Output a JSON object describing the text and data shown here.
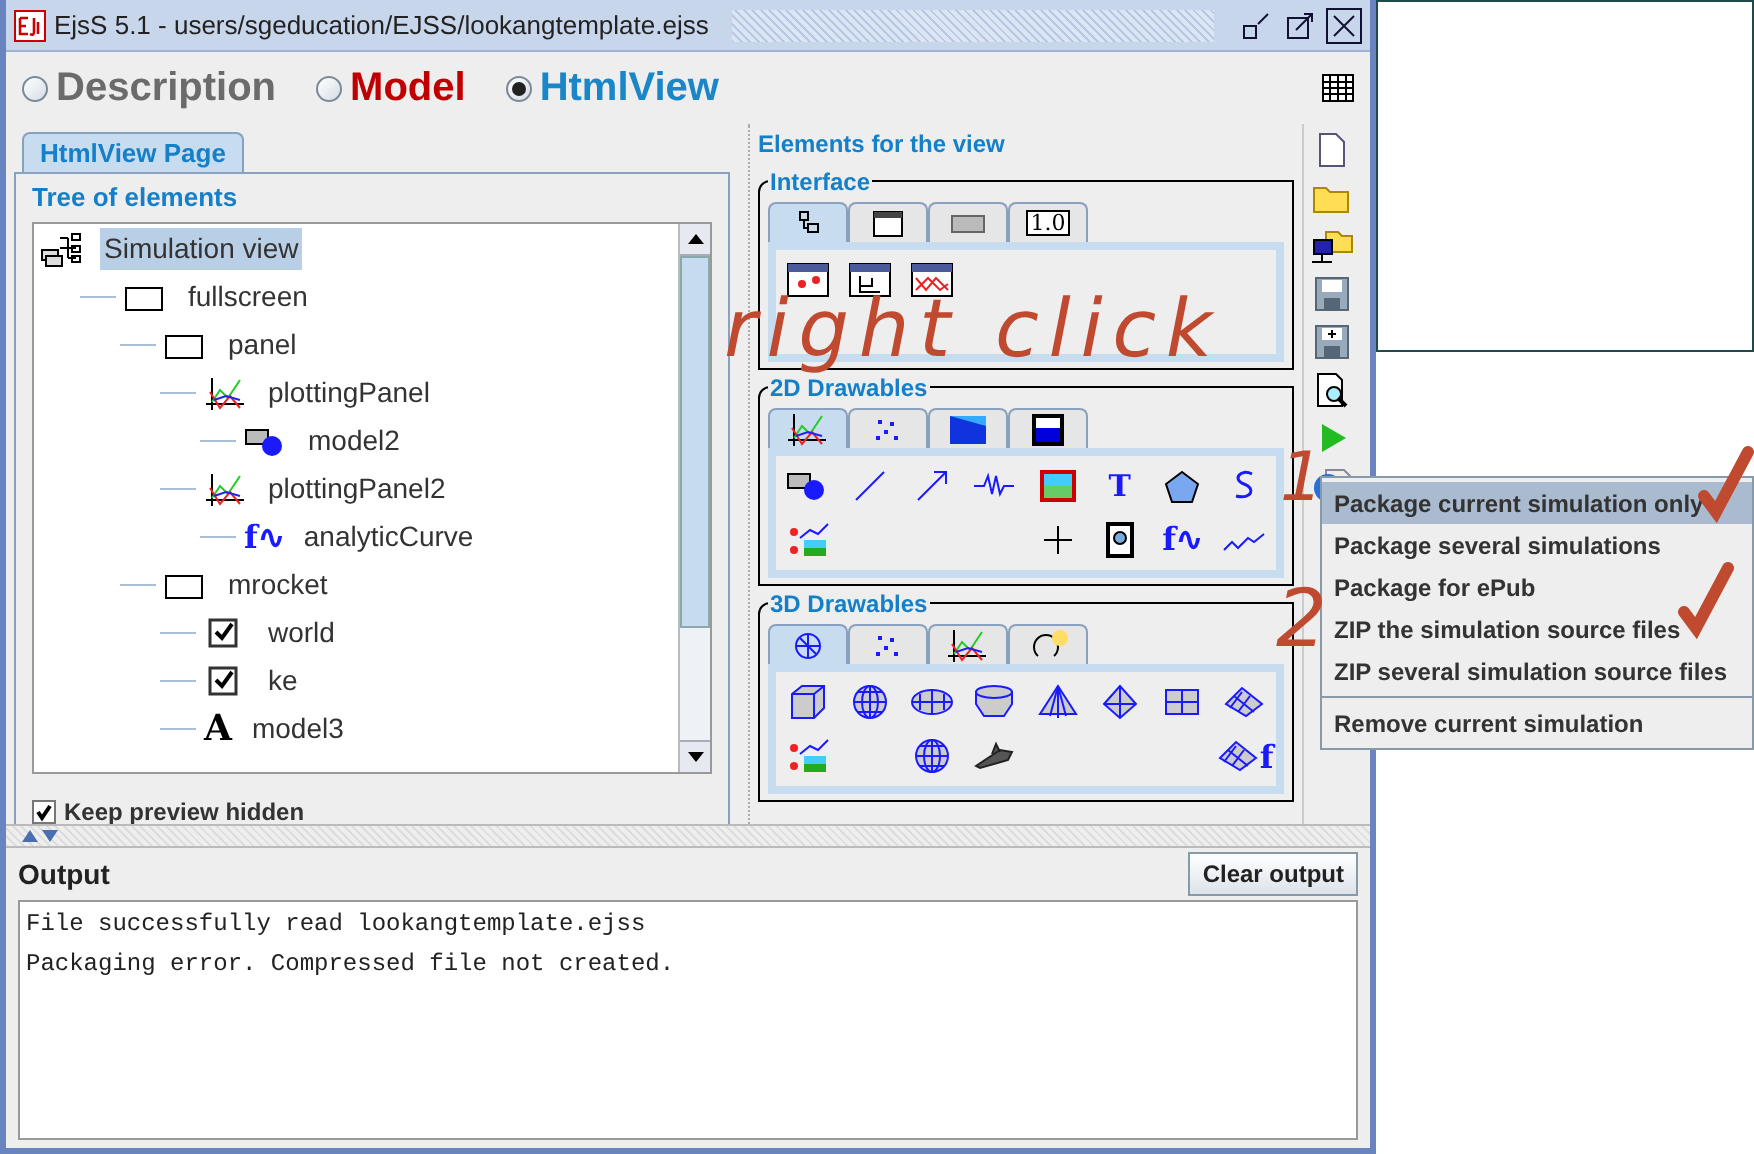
{
  "window": {
    "title": "EjsS 5.1 - users/sgeducation/EJSS/lookangtemplate.ejss"
  },
  "modes": [
    {
      "label": "Description",
      "selected": false,
      "color": "#6b6b6b"
    },
    {
      "label": "Model",
      "selected": false,
      "color": "#c00000"
    },
    {
      "label": "HtmlView",
      "selected": true,
      "color": "#1a86c8"
    }
  ],
  "page_tab": {
    "label": "HtmlView Page",
    "selected": true
  },
  "tree": {
    "title": "Tree of elements",
    "items": [
      {
        "label": "Simulation view",
        "kind": "view",
        "selected": true,
        "children": [
          {
            "label": "fullscreen",
            "kind": "frame",
            "selected": false,
            "children": [
              {
                "label": "panel",
                "kind": "frame",
                "selected": false,
                "children": [
                  {
                    "label": "plottingPanel",
                    "kind": "plot",
                    "selected": false,
                    "children": [
                      {
                        "label": "model2",
                        "kind": "shape",
                        "selected": false
                      }
                    ]
                  },
                  {
                    "label": "plottingPanel2",
                    "kind": "plot",
                    "selected": false,
                    "children": [
                      {
                        "label": "analyticCurve",
                        "kind": "curve",
                        "glyph": "f∿",
                        "selected": false
                      }
                    ]
                  }
                ]
              },
              {
                "label": "mrocket",
                "kind": "frame",
                "selected": false,
                "children": [
                  {
                    "label": "world",
                    "kind": "check",
                    "selected": false
                  },
                  {
                    "label": "ke",
                    "kind": "check",
                    "selected": false
                  },
                  {
                    "label": "model3",
                    "kind": "text",
                    "glyph": "A",
                    "selected": false
                  }
                ]
              }
            ]
          }
        ]
      }
    ]
  },
  "keep_preview_hidden": {
    "label": "Keep preview hidden",
    "checked": true
  },
  "elements": {
    "title": "Elements for the view",
    "groups": [
      {
        "title": "Interface",
        "tabs": [
          {
            "kind": "tree",
            "selected": true
          },
          {
            "kind": "window",
            "selected": false
          },
          {
            "kind": "button",
            "selected": false
          },
          {
            "kind": "number",
            "glyph": "1.0",
            "selected": false
          }
        ],
        "items": [
          {
            "kind": "window-dots"
          },
          {
            "kind": "window-axes"
          },
          {
            "kind": "window-plot"
          }
        ]
      },
      {
        "title": "2D Drawables",
        "tabs": [
          {
            "kind": "plot-dots",
            "selected": true
          },
          {
            "kind": "points",
            "selected": false
          },
          {
            "kind": "gradient",
            "selected": false
          },
          {
            "kind": "tank",
            "selected": false
          }
        ],
        "items": [
          {
            "kind": "shape"
          },
          {
            "kind": "line"
          },
          {
            "kind": "arrow"
          },
          {
            "kind": "spring"
          },
          {
            "kind": "image"
          },
          {
            "kind": "text",
            "glyph": "T"
          },
          {
            "kind": "polygon"
          },
          {
            "kind": "trace"
          },
          {
            "kind": "composite"
          },
          {
            "kind": "empty"
          },
          {
            "kind": "empty"
          },
          {
            "kind": "empty"
          },
          {
            "kind": "cross"
          },
          {
            "kind": "video"
          },
          {
            "kind": "curve",
            "glyph": "f∿"
          },
          {
            "kind": "trail"
          }
        ]
      },
      {
        "title": "3D Drawables",
        "tabs": [
          {
            "kind": "axes3d",
            "selected": true
          },
          {
            "kind": "points",
            "selected": false
          },
          {
            "kind": "plot-dots",
            "selected": false
          },
          {
            "kind": "rotate",
            "selected": false
          }
        ],
        "items": [
          {
            "kind": "cube"
          },
          {
            "kind": "sphere"
          },
          {
            "kind": "ellipsoid"
          },
          {
            "kind": "cylinder"
          },
          {
            "kind": "cone"
          },
          {
            "kind": "pyramid"
          },
          {
            "kind": "plane"
          },
          {
            "kind": "surface"
          },
          {
            "kind": "composite"
          },
          {
            "kind": "empty"
          },
          {
            "kind": "web"
          },
          {
            "kind": "shuttle"
          },
          {
            "kind": "empty"
          },
          {
            "kind": "empty"
          },
          {
            "kind": "empty"
          },
          {
            "kind": "surface-f",
            "glyph": "f"
          }
        ]
      }
    ]
  },
  "toolbar": [
    {
      "kind": "new"
    },
    {
      "kind": "open"
    },
    {
      "kind": "open-network"
    },
    {
      "kind": "save"
    },
    {
      "kind": "save-as"
    },
    {
      "kind": "inspect"
    },
    {
      "kind": "run"
    },
    {
      "kind": "package"
    }
  ],
  "context_menu": [
    {
      "label": "Package current simulation only",
      "selected": true,
      "separator_before": false
    },
    {
      "label": "Package several simulations",
      "selected": false,
      "separator_before": false
    },
    {
      "label": "Package for ePub",
      "selected": false,
      "separator_before": false
    },
    {
      "label": "ZIP the simulation source files",
      "selected": false,
      "separator_before": false
    },
    {
      "label": "ZIP several simulation source files",
      "selected": false,
      "separator_before": false
    },
    {
      "label": "Remove current simulation",
      "selected": false,
      "separator_before": true
    }
  ],
  "output": {
    "title": "Output",
    "button": "Clear output",
    "lines": [
      "File successfully read lookangtemplate.ejss",
      "Packaging error. Compressed file not created."
    ]
  },
  "annotations": [
    {
      "kind": "text",
      "text": "right click"
    },
    {
      "kind": "text",
      "text": "1"
    },
    {
      "kind": "text",
      "text": "2"
    },
    {
      "kind": "tick"
    },
    {
      "kind": "tick"
    }
  ]
}
